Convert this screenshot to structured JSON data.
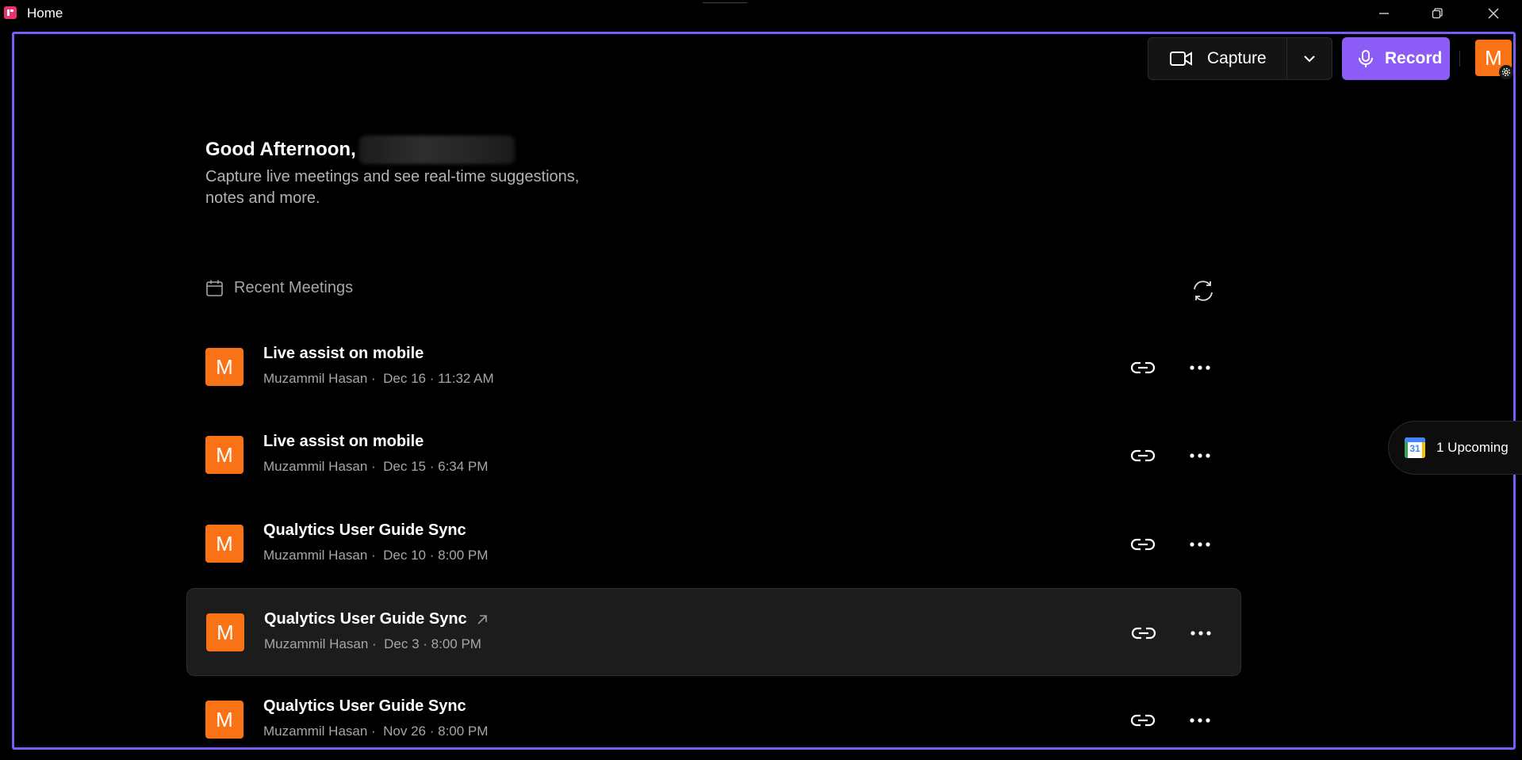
{
  "window": {
    "title": "Home"
  },
  "toolbar": {
    "capture_label": "Capture",
    "record_label": "Record",
    "avatar_initial": "M"
  },
  "greeting": {
    "headline": "Good Afternoon,",
    "subtitle": "Capture live meetings and see real-time suggestions, notes and more."
  },
  "recent": {
    "header": "Recent Meetings",
    "meetings": [
      {
        "initial": "M",
        "title": "Live assist on mobile",
        "meta": "Muzammil Hasan ·  Dec 16 · 11:32 AM"
      },
      {
        "initial": "M",
        "title": "Live assist on mobile",
        "meta": "Muzammil Hasan ·  Dec 15 · 6:34 PM"
      },
      {
        "initial": "M",
        "title": "Qualytics User Guide Sync",
        "meta": "Muzammil Hasan ·  Dec 10 · 8:00 PM"
      },
      {
        "initial": "M",
        "title": "Qualytics User Guide Sync",
        "meta": "Muzammil Hasan ·  Dec 3 · 8:00 PM"
      },
      {
        "initial": "M",
        "title": "Qualytics User Guide Sync",
        "meta": "Muzammil Hasan ·  Nov 26 · 8:00 PM"
      }
    ]
  },
  "upcoming": {
    "label": "1 Upcoming",
    "calendar_day": "31"
  },
  "colors": {
    "accent": "#8b5cf6",
    "avatar": "#f97316",
    "frame": "#7c5cf5"
  }
}
